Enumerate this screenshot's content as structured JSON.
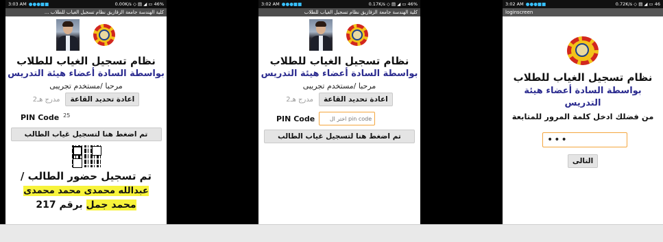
{
  "screens": {
    "left": {
      "status": {
        "time": "3:03 AM",
        "speed": "0.00K/s",
        "battery": "46%"
      },
      "titlebar": "كلية الهندسة جامعة الزقازيق نظام تسجيل الغياب للطلاب ...",
      "title": "نظام تسجيل الغياب  للطلاب",
      "subtitle": "بواسطة السادة أعضاء هيئة التدريس",
      "welcome": "مرحبا /مستخدم تجريبى",
      "set_hall_button": "اعادة تحديد القاعة",
      "hall_value": "مدرج هـ2",
      "pin_label": "PIN Code",
      "pin_value": "25",
      "register_button": "تم اضغط هنا  لتسجيل غياب الطالب",
      "result_line1": "تم تسجيل حضور الطالب /",
      "result_line2": "عبدالله محمدى محمد محمدى",
      "result_name_end": "محمد جمل",
      "result_number_label": "برقم",
      "result_number": "217"
    },
    "middle": {
      "status": {
        "time": "3:02 AM",
        "speed": "0.17K/s",
        "battery": "46%"
      },
      "titlebar": "كلية الهندسة جامعة الزقازيق نظام تسجيل الغياب للطلاب",
      "title": "نظام تسجيل الغياب  للطلاب",
      "subtitle": "بواسطة السادة أعضاء هيئة التدريس",
      "welcome": "مرحبا /مستخدم تجريبى",
      "set_hall_button": "اعادة تحديد القاعة",
      "hall_value": "مدرج هـ2",
      "pin_label": "PIN Code",
      "pin_placeholder": "اختر ال pin code",
      "register_button": "تم اضغط هنا  لتسجيل غياب الطالب"
    },
    "right": {
      "status": {
        "time": "3:02 AM",
        "speed": "0.72K/s",
        "battery": "46"
      },
      "titlebar": "loginscreen",
      "title": "نظام تسجيل الغياب  للطلاب",
      "subtitle_line1": "بواسطة السادة أعضاء هيئة",
      "subtitle_line2": "التدريس",
      "prompt": "من فضلك ادخل كلمة المرور للمتابعة",
      "password_value": "•••",
      "next_button": "التالى"
    }
  }
}
